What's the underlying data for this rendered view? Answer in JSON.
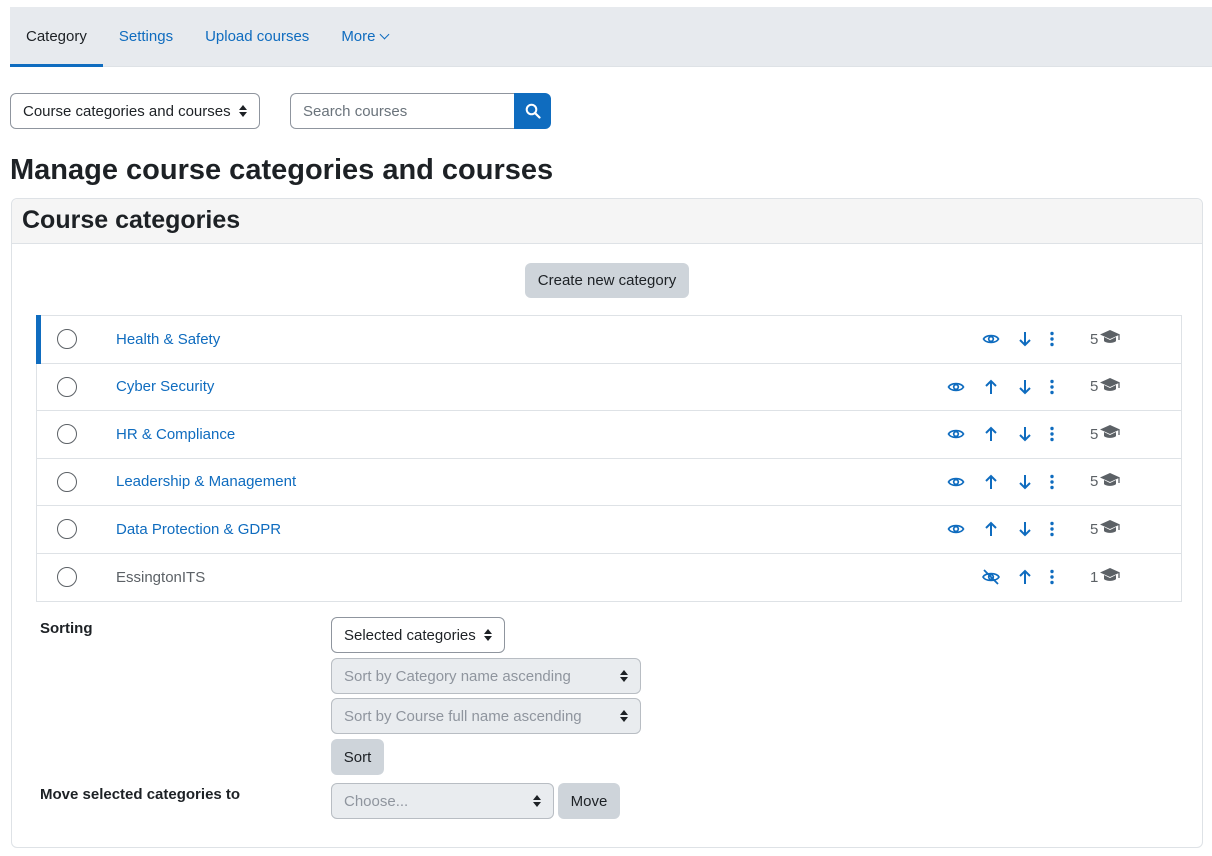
{
  "topnav": {
    "tabs": [
      {
        "label": "Category",
        "active": true
      },
      {
        "label": "Settings",
        "active": false
      },
      {
        "label": "Upload courses",
        "active": false
      },
      {
        "label": "More",
        "active": false
      }
    ]
  },
  "view_select": {
    "value": "Course categories and courses"
  },
  "search": {
    "placeholder": "Search courses"
  },
  "page_title": "Manage course categories and courses",
  "categories_card": {
    "title": "Course categories",
    "create_button": "Create new category",
    "rows": [
      {
        "name": "Health & Safety",
        "visible": true,
        "can_move_up": false,
        "can_move_down": true,
        "count": "5",
        "current": true
      },
      {
        "name": "Cyber Security",
        "visible": true,
        "can_move_up": true,
        "can_move_down": true,
        "count": "5",
        "current": false
      },
      {
        "name": "HR & Compliance",
        "visible": true,
        "can_move_up": true,
        "can_move_down": true,
        "count": "5",
        "current": false
      },
      {
        "name": "Leadership & Management",
        "visible": true,
        "can_move_up": true,
        "can_move_down": true,
        "count": "5",
        "current": false
      },
      {
        "name": "Data Protection & GDPR",
        "visible": true,
        "can_move_up": true,
        "can_move_down": true,
        "count": "5",
        "current": false
      },
      {
        "name": "EssingtonITS",
        "visible": false,
        "can_move_up": true,
        "can_move_down": false,
        "count": "1",
        "current": false
      }
    ]
  },
  "sorting": {
    "label": "Sorting",
    "scope_select": "Selected categories",
    "category_sort_select": "Sort by Category name ascending",
    "course_sort_select": "Sort by Course full name ascending",
    "sort_button": "Sort"
  },
  "move": {
    "label": "Move selected categories to",
    "select_placeholder": "Choose...",
    "move_button": "Move"
  },
  "colors": {
    "accent": "#0f6cbf",
    "nav_bg": "#e7eaee",
    "button_secondary": "#ced4da"
  },
  "icons": {
    "search": "search-icon",
    "visible": "eye-icon",
    "hidden": "eye-slash-icon",
    "up": "arrow-up-icon",
    "down": "arrow-down-icon",
    "menu": "kebab-menu-icon",
    "courses": "graduation-cap-icon"
  }
}
